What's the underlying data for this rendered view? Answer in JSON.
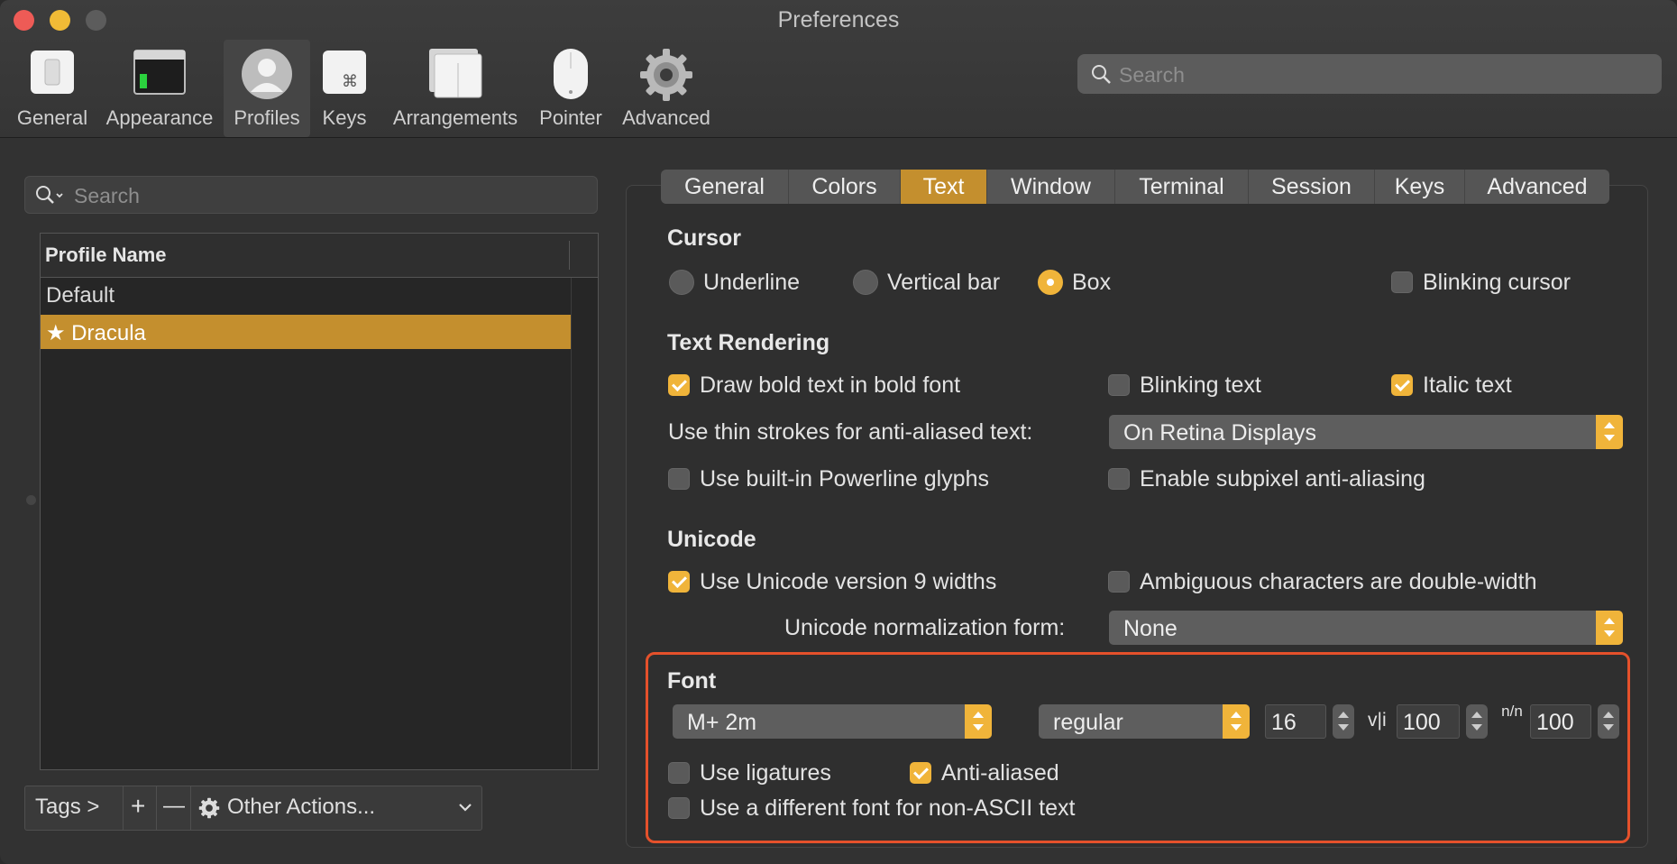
{
  "window": {
    "title": "Preferences"
  },
  "toolbar": {
    "items": [
      {
        "label": "General",
        "icon": "general-icon"
      },
      {
        "label": "Appearance",
        "icon": "appearance-icon"
      },
      {
        "label": "Profiles",
        "icon": "profiles-icon",
        "active": true
      },
      {
        "label": "Keys",
        "icon": "keys-icon"
      },
      {
        "label": "Arrangements",
        "icon": "arrangements-icon"
      },
      {
        "label": "Pointer",
        "icon": "pointer-icon"
      },
      {
        "label": "Advanced",
        "icon": "gear-icon"
      }
    ],
    "search_placeholder": "Search"
  },
  "profiles": {
    "search_placeholder": "Search",
    "column_header": "Profile Name",
    "rows": [
      {
        "name": "Default"
      },
      {
        "name": "★ Dracula",
        "selected": true
      }
    ],
    "bottom_bar": {
      "tags": "Tags >",
      "add": "+",
      "remove": "—",
      "other_actions": "Other Actions..."
    }
  },
  "tabs": [
    "General",
    "Colors",
    "Text",
    "Window",
    "Terminal",
    "Session",
    "Keys",
    "Advanced"
  ],
  "active_tab": "Text",
  "cursor": {
    "title": "Cursor",
    "options": [
      "Underline",
      "Vertical bar",
      "Box"
    ],
    "selected": "Box",
    "blinking_label": "Blinking cursor",
    "blinking": false
  },
  "text_rendering": {
    "title": "Text Rendering",
    "bold_label": "Draw bold text in bold font",
    "bold": true,
    "blinking_text_label": "Blinking text",
    "blinking_text": false,
    "italic_label": "Italic text",
    "italic": true,
    "thin_strokes_label": "Use thin strokes for anti-aliased text:",
    "thin_strokes_value": "On Retina Displays",
    "powerline_label": "Use built-in Powerline glyphs",
    "powerline": false,
    "subpixel_label": "Enable subpixel anti-aliasing",
    "subpixel": false
  },
  "unicode": {
    "title": "Unicode",
    "v9_label": "Use Unicode version 9 widths",
    "v9": true,
    "ambiguous_label": "Ambiguous characters are double-width",
    "ambiguous": false,
    "normalization_label": "Unicode normalization form:",
    "normalization_value": "None"
  },
  "font": {
    "title": "Font",
    "family": "M+ 2m",
    "weight": "regular",
    "size": "16",
    "hspacing_glyph": "v|i",
    "hspacing": "100",
    "vspacing_glyph": "n/n",
    "vspacing": "100",
    "ligatures_label": "Use ligatures",
    "ligatures": false,
    "antialiased_label": "Anti-aliased",
    "antialiased": true,
    "nonascii_label": "Use a different font for non-ASCII text",
    "nonascii": false
  },
  "colors": {
    "accent": "#f0b43a",
    "selection": "#c48f2e",
    "highlight": "#e5512b"
  }
}
